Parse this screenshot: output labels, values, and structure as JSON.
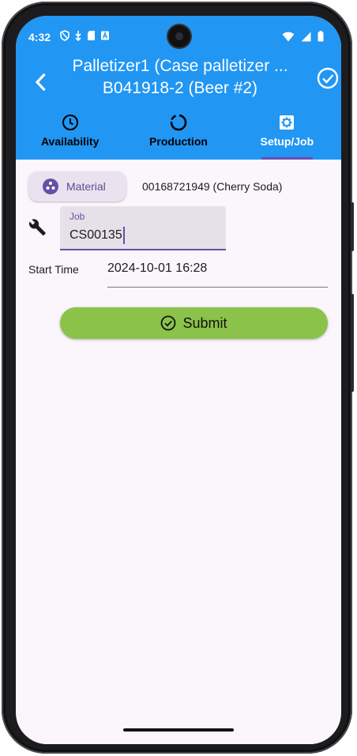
{
  "status_bar": {
    "time": "4:32"
  },
  "header": {
    "title_line1": "Palletizer1 (Case palletizer ...",
    "title_line2": "B041918-2 (Beer #2)"
  },
  "tabs": [
    {
      "label": "Availability",
      "icon": "clock-icon",
      "active": false
    },
    {
      "label": "Production",
      "icon": "progress-ring-icon",
      "active": false
    },
    {
      "label": "Setup/Job",
      "icon": "gear-icon",
      "active": true
    }
  ],
  "material": {
    "chip_label": "Material",
    "value": "00168721949 (Cherry Soda)"
  },
  "job": {
    "label": "Job",
    "value": "CS00135"
  },
  "start_time": {
    "label": "Start Time",
    "value": "2024-10-01 16:28"
  },
  "submit_label": "Submit",
  "colors": {
    "app_bar": "#2196f3",
    "accent": "#6750a4",
    "submit": "#8bc34a",
    "background": "#fbf5fc"
  }
}
